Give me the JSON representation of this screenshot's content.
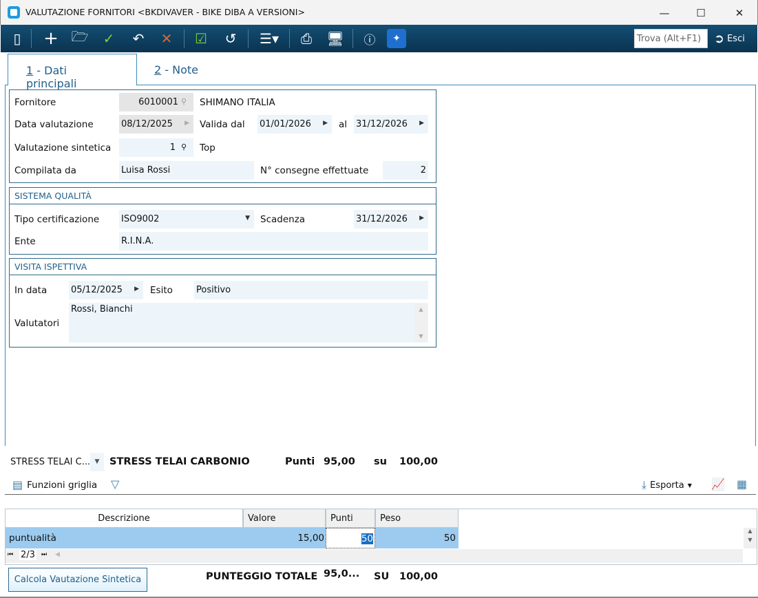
{
  "window": {
    "title": "VALUTAZIONE FORNITORI <BKDIVAVER - BIKE DIBA A VERSIONI>"
  },
  "toolbar": {
    "search_placeholder": "Trova (Alt+F1)",
    "exit_label": "Esci"
  },
  "tabs": [
    {
      "key": "1",
      "label": " - Dati principali"
    },
    {
      "key": "2",
      "label": " - Note"
    }
  ],
  "main": {
    "fornitore_label": "Fornitore",
    "fornitore_code": "6010001",
    "fornitore_name": "SHIMANO ITALIA",
    "data_label": "Data valutazione",
    "data_value": "08/12/2025",
    "valida_label": "Valida dal",
    "valida_dal": "01/01/2026",
    "al_label": "al",
    "valida_al": "31/12/2026",
    "sintetica_label": "Valutazione sintetica",
    "sintetica_value": "1",
    "sintetica_desc": "Top",
    "compilata_label": "Compilata da",
    "compilata_value": "Luisa Rossi",
    "consegne_label": "N° consegne effettuate",
    "consegne_value": "2"
  },
  "qualita": {
    "title": "SISTEMA QUALITÀ",
    "tipo_label": "Tipo certificazione",
    "tipo_value": "ISO9002",
    "scadenza_label": "Scadenza",
    "scadenza_value": "31/12/2026",
    "ente_label": "Ente",
    "ente_value": "R.I.N.A."
  },
  "visita": {
    "title": "VISITA ISPETTIVA",
    "data_label": "In data",
    "data_value": "05/12/2025",
    "esito_label": "Esito",
    "esito_value": "Positivo",
    "valutatori_label": "Valutatori",
    "valutatori_value": "Rossi, Bianchi"
  },
  "criterio": {
    "select": "STRESS TELAI C...",
    "name": "STRESS TELAI CARBONIO",
    "punti_label": "Punti",
    "punti": "95,00",
    "su_label": "su",
    "su": "100,00"
  },
  "grid_toolbar": {
    "functions": "Funzioni griglia",
    "export": "Esporta"
  },
  "grid": {
    "headers": [
      "Descrizione",
      "Valore",
      "Punti",
      "Peso"
    ],
    "row": [
      "puntualità",
      "15,00",
      "50",
      "50"
    ],
    "pager": "2/3"
  },
  "footer": {
    "button": "Calcola Vautazione Sintetica",
    "totale_label": "PUNTEGGIO TOTALE",
    "totale": "95,0...",
    "su_label": "SU",
    "su": "100,00"
  }
}
